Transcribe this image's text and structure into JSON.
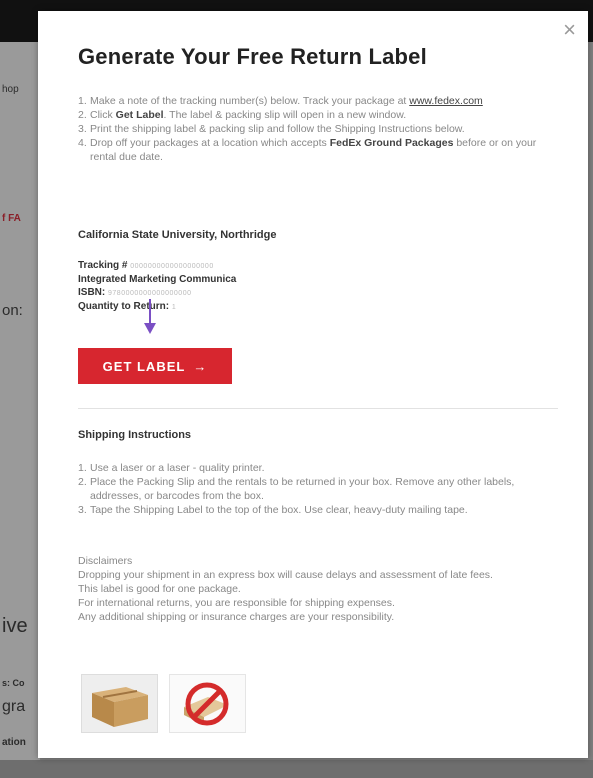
{
  "background": {
    "fragments": [
      "hop",
      "f FA",
      "on:",
      "ive",
      "s: Co",
      "gra",
      "ation"
    ]
  },
  "modal": {
    "title": "Generate Your Free Return Label",
    "close_glyph": "×",
    "steps": [
      {
        "num": "1.",
        "pre": "Make a note of the tracking number(s) below. Track your package at ",
        "link": "www.fedex.com",
        "post": ""
      },
      {
        "num": "2.",
        "pre": "Click ",
        "bold": "Get Label",
        "post": ". The label & packing slip will open in a new window."
      },
      {
        "num": "3.",
        "pre": "Print the shipping label & packing slip and follow the Shipping Instructions below.",
        "post": ""
      },
      {
        "num": "4.",
        "pre": "Drop off your packages at a location which accepts ",
        "bold": "FedEx Ground Packages",
        "post": " before or on your rental due date."
      }
    ],
    "school": "California State University, Northridge",
    "tracking_label": "Tracking #",
    "tracking_value": "0000000000000000000",
    "course": "Integrated Marketing Communica",
    "isbn_label": "ISBN:",
    "isbn_value": "9780000000000000000",
    "quantity_label": "Quantity to Return:",
    "quantity_value": "1",
    "get_label_button": "GET LABEL",
    "arrow_glyph": "→",
    "shipping_heading": "Shipping Instructions",
    "shipping_steps": [
      {
        "num": "1.",
        "text": "Use a laser or a laser - quality printer."
      },
      {
        "num": "2.",
        "text": "Place the Packing Slip and the rentals to be returned in your box. Remove any other labels, addresses, or barcodes from the box."
      },
      {
        "num": "3.",
        "text": "Tape the Shipping Label to the top of the box. Use clear, heavy-duty mailing tape."
      }
    ],
    "disclaimers": [
      "Disclaimers",
      "Dropping your shipment in an express box will cause delays and assessment of late fees.",
      "This label is good for one package.",
      "For international returns, you are responsible for shipping expenses.",
      "Any additional shipping or insurance charges are your responsibility."
    ],
    "images": {
      "box_icon": "cardboard-box",
      "no_icon": "prohibited-sign"
    }
  },
  "colors": {
    "accent": "#d7262f",
    "arrow": "#7a4fc4"
  }
}
